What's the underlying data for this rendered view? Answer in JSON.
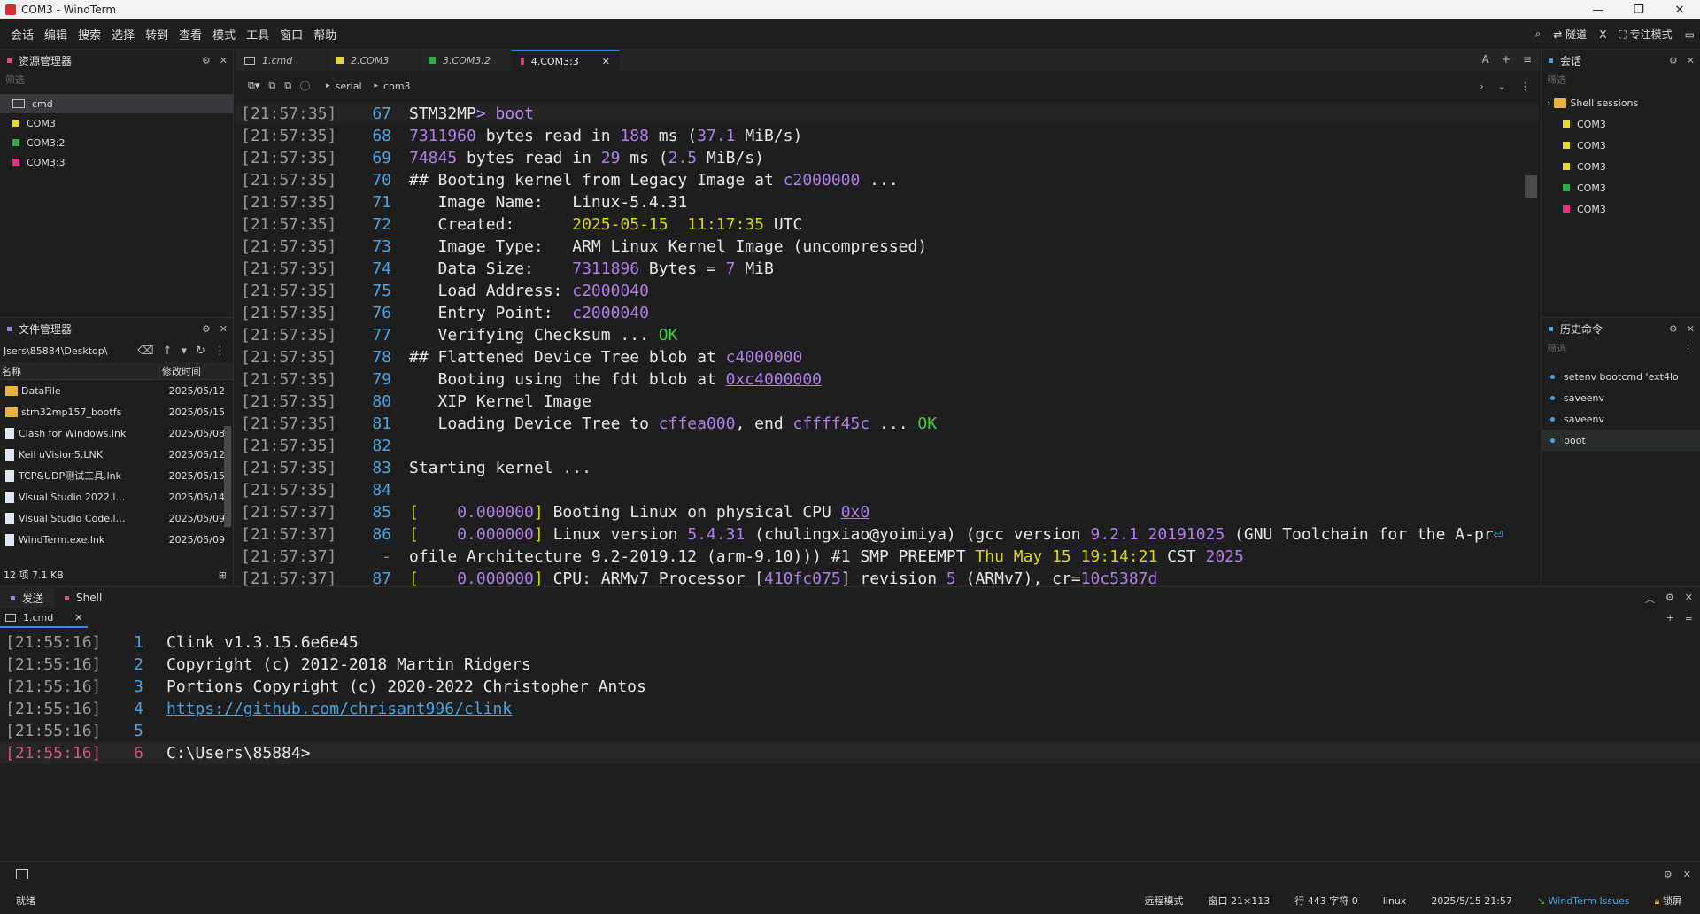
{
  "window": {
    "title": "COM3 - WindTerm"
  },
  "menu": {
    "items": [
      "会话",
      "编辑",
      "搜索",
      "选择",
      "转到",
      "查看",
      "模式",
      "工具",
      "窗口",
      "帮助"
    ],
    "tunnel": "隧道",
    "x": "X",
    "focus_mode": "专注模式"
  },
  "explorer": {
    "title": "资源管理器",
    "filter": "筛选",
    "items": [
      {
        "label": "cmd",
        "color": ""
      },
      {
        "label": "COM3",
        "color": "#e8d33a"
      },
      {
        "label": "COM3:2",
        "color": "#2eaa44"
      },
      {
        "label": "COM3:3",
        "color": "#e0357a"
      }
    ]
  },
  "filemgr": {
    "title": "文件管理器",
    "path": "Jsers\\85884\\Desktop\\",
    "col_name": "名称",
    "col_date": "修改时间",
    "files": [
      {
        "name": "DataFile",
        "date": "2025/05/12",
        "type": "folder"
      },
      {
        "name": "stm32mp157_bootfs",
        "date": "2025/05/15",
        "type": "folder"
      },
      {
        "name": "Clash for Windows.lnk",
        "date": "2025/05/08",
        "type": "file"
      },
      {
        "name": "Keil uVision5.LNK",
        "date": "2025/05/12",
        "type": "file"
      },
      {
        "name": "TCP&UDP测试工具.lnk",
        "date": "2025/05/15",
        "type": "file"
      },
      {
        "name": "Visual Studio 2022.l…",
        "date": "2025/05/14",
        "type": "file"
      },
      {
        "name": "Visual Studio Code.l…",
        "date": "2025/05/09",
        "type": "file"
      },
      {
        "name": "WindTerm.exe.lnk",
        "date": "2025/05/09",
        "type": "file"
      }
    ],
    "status": "12 项 7.1 KB"
  },
  "tabs": [
    {
      "label": "1.cmd",
      "color": "",
      "active": false
    },
    {
      "label": "2.COM3",
      "color": "#e8d33a",
      "active": false
    },
    {
      "label": "3.COM3:2",
      "color": "#2eaa44",
      "active": false
    },
    {
      "label": "4.COM3:3",
      "color": "#e0357a",
      "active": true
    }
  ],
  "tab_right": {
    "font": "A",
    "plus": "+",
    "menu": "≡"
  },
  "toolbar": {
    "crumbs": [
      "serial",
      "com3"
    ]
  },
  "terminal": {
    "lines": [
      {
        "ts": "[21:57:35]",
        "ln": "67",
        "html": "STM32MP<span class='c-pr'>&gt;</span> <span class='c-pr'>boot</span>",
        "raw": "STM32MP> boot"
      },
      {
        "ts": "[21:57:35]",
        "ln": "68",
        "html": "<span class='c-num'>7311960</span> bytes read in <span class='c-num'>188</span> ms (<span class='c-num'>37.1</span> MiB/s)",
        "raw": "7311960 bytes read in 188 ms (37.1 MiB/s)"
      },
      {
        "ts": "[21:57:35]",
        "ln": "69",
        "html": "<span class='c-num'>74845</span> bytes read in <span class='c-num'>29</span> ms (<span class='c-num'>2.5</span> MiB/s)",
        "raw": "74845 bytes read in 29 ms (2.5 MiB/s)"
      },
      {
        "ts": "[21:57:35]",
        "ln": "70",
        "html": "## Booting kernel from Legacy Image at <span class='c-num'>c2000000</span> ...",
        "raw": "## Booting kernel from Legacy Image at c2000000 ..."
      },
      {
        "ts": "[21:57:35]",
        "ln": "71",
        "html": "   Image Name:   Linux-5.4.31",
        "raw": "   Image Name:   Linux-5.4.31"
      },
      {
        "ts": "[21:57:35]",
        "ln": "72",
        "html": "   Created:      <span class='c-yel'>2025-05-15  11:17:35</span> UTC",
        "raw": "   Created:      2025-05-15  11:17:35 UTC"
      },
      {
        "ts": "[21:57:35]",
        "ln": "73",
        "html": "   Image Type:   ARM Linux Kernel Image (uncompressed)",
        "raw": "   Image Type:   ARM Linux Kernel Image (uncompressed)"
      },
      {
        "ts": "[21:57:35]",
        "ln": "74",
        "html": "   Data Size:    <span class='c-num'>7311896</span> Bytes = <span class='c-num'>7</span> MiB",
        "raw": "   Data Size:    7311896 Bytes = 7 MiB"
      },
      {
        "ts": "[21:57:35]",
        "ln": "75",
        "html": "   Load Address: <span class='c-num'>c2000040</span>",
        "raw": "   Load Address: c2000040"
      },
      {
        "ts": "[21:57:35]",
        "ln": "76",
        "html": "   Entry Point:  <span class='c-num'>c2000040</span>",
        "raw": "   Entry Point:  c2000040"
      },
      {
        "ts": "[21:57:35]",
        "ln": "77",
        "html": "   Verifying Checksum ... <span class='c-grn'>OK</span>",
        "raw": "   Verifying Checksum ... OK"
      },
      {
        "ts": "[21:57:35]",
        "ln": "78",
        "html": "## Flattened Device Tree blob at <span class='c-num'>c4000000</span>",
        "raw": "## Flattened Device Tree blob at c4000000"
      },
      {
        "ts": "[21:57:35]",
        "ln": "79",
        "html": "   Booting using the fdt blob at <span class='c-lnk'>0xc4000000</span>",
        "raw": "   Booting using the fdt blob at 0xc4000000"
      },
      {
        "ts": "[21:57:35]",
        "ln": "80",
        "html": "   XIP Kernel Image",
        "raw": "   XIP Kernel Image"
      },
      {
        "ts": "[21:57:35]",
        "ln": "81",
        "html": "   Loading Device Tree to <span class='c-num'>cffea000</span>, end <span class='c-num'>cffff45c</span> ... <span class='c-grn'>OK</span>",
        "raw": "   Loading Device Tree to cffea000, end cffff45c ... OK"
      },
      {
        "ts": "[21:57:35]",
        "ln": "82",
        "html": "",
        "raw": ""
      },
      {
        "ts": "[21:57:35]",
        "ln": "83",
        "html": "Starting kernel ...",
        "raw": "Starting kernel ..."
      },
      {
        "ts": "[21:57:35]",
        "ln": "84",
        "html": "",
        "raw": ""
      },
      {
        "ts": "[21:57:37]",
        "ln": "85",
        "html": "<span class='c-yel'>[</span>    <span class='c-num'>0.000000</span><span class='c-yel'>]</span> Booting Linux on physical CPU <span class='c-lnk'>0x0</span>",
        "raw": "[    0.000000] Booting Linux on physical CPU 0x0"
      },
      {
        "ts": "[21:57:37]",
        "ln": "86",
        "html": "<span class='c-yel'>[</span>    <span class='c-num'>0.000000</span><span class='c-yel'>]</span> Linux version <span class='c-num'>5.4.31</span> (chulingxiao@yoimiya) (gcc version <span class='c-num'>9.2.1 20191025</span> (GNU Toolchain for the A-pr<span style='color:#4aa3e0'>⏎</span>",
        "raw": "[    0.000000] Linux version 5.4.31 (chulingxiao@yoimiya) (gcc version 9.2.1 20191025 (GNU Toolchain for the A-pr"
      },
      {
        "ts": "[21:57:37]",
        "ln": "-",
        "html": "ofile Architecture 9.2-2019.12 (arm-9.10))) #1 SMP PREEMPT <span class='c-yel'>Thu May 15 19:14:21</span> CST <span class='c-num'>2025</span>",
        "raw": "ofile Architecture 9.2-2019.12 (arm-9.10))) #1 SMP PREEMPT Thu May 15 19:14:21 CST 2025"
      },
      {
        "ts": "[21:57:37]",
        "ln": "87",
        "html": "<span class='c-yel'>[</span>    <span class='c-num'>0.000000</span><span class='c-yel'>]</span> CPU: ARMv7 Processor [<span class='c-num'>410fc075</span>] revision <span class='c-num'>5</span> (ARMv7), cr=<span class='c-num'>10c5387d</span>",
        "raw": "[    0.000000] CPU: ARMv7 Processor [410fc075] revision 5 (ARMv7), cr=10c5387d"
      }
    ]
  },
  "sessions": {
    "title": "会话",
    "filter": "筛选",
    "root": "Shell sessions",
    "items": [
      {
        "label": "COM3",
        "color": "#e8d33a"
      },
      {
        "label": "COM3",
        "color": "#e8d33a"
      },
      {
        "label": "COM3",
        "color": "#e8d33a"
      },
      {
        "label": "COM3",
        "color": "#2eaa44"
      },
      {
        "label": "COM3",
        "color": "#e0357a"
      }
    ]
  },
  "history": {
    "title": "历史命令",
    "filter": "筛选",
    "items": [
      "setenv bootcmd 'ext4lo",
      "saveenv",
      "saveenv",
      "boot"
    ]
  },
  "bottom": {
    "tabs": [
      "发送",
      "Shell"
    ],
    "subtab": "1.cmd",
    "lines": [
      {
        "ts": "[21:55:16]",
        "ln": "1",
        "text": "Clink v1.3.15.6e6e45"
      },
      {
        "ts": "[21:55:16]",
        "ln": "2",
        "text": "Copyright (c) 2012-2018 Martin Ridgers"
      },
      {
        "ts": "[21:55:16]",
        "ln": "3",
        "text": "Portions Copyright (c) 2020-2022 Christopher Antos"
      },
      {
        "ts": "[21:55:16]",
        "ln": "4",
        "text": "https://github.com/chrisant996/clink"
      },
      {
        "ts": "[21:55:16]",
        "ln": "5",
        "text": ""
      },
      {
        "ts": "[21:55:16]",
        "ln": "6",
        "text": "C:\\Users\\85884>"
      }
    ]
  },
  "status": {
    "ready": "就绪",
    "remote_mode": "远程模式",
    "window_size": "窗口 21×113",
    "cursor": "行 443 字符 0",
    "os": "linux",
    "datetime": "2025/5/15 21:57",
    "issues": "WindTerm Issues",
    "lock": "锁屏"
  }
}
